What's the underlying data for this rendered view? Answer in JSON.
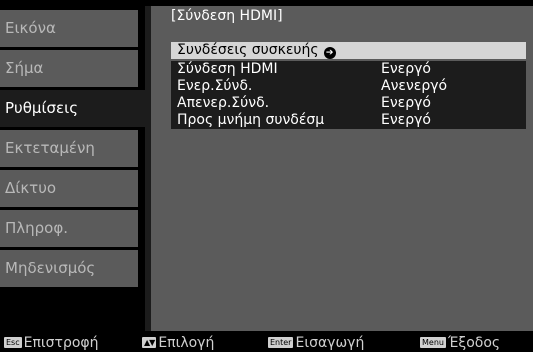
{
  "sidebar": {
    "items": [
      {
        "label": "Εικόνα"
      },
      {
        "label": "Σήμα"
      },
      {
        "label": "Ρυθμίσεις"
      },
      {
        "label": "Εκτεταμένη"
      },
      {
        "label": "Δίκτυο"
      },
      {
        "label": "Πληροφ."
      },
      {
        "label": "Μηδενισμός"
      }
    ],
    "active_index": 2
  },
  "panel": {
    "title": "[Σύνδεση HDMI]",
    "rows": [
      {
        "label": "Συνδέσεις συσκευής",
        "value": "",
        "icon": "enter-arrow-icon",
        "selected": true
      },
      {
        "label": "Σύνδεση HDMI",
        "value": "Ενεργό"
      },
      {
        "label": "Ενερ.Σύνδ.",
        "value": "Ανενεργό"
      },
      {
        "label": "Απενερ.Σύνδ.",
        "value": "Ενεργό"
      },
      {
        "label": "Προς μνήμη συνδέσμ",
        "value": "Ενεργό"
      }
    ]
  },
  "helpbar": {
    "items": [
      {
        "key": "Esc",
        "label": "Επιστροφή"
      },
      {
        "key": "▲▼",
        "label": "Επιλογή"
      },
      {
        "key": "Enter",
        "label": "Εισαγωγή"
      },
      {
        "key": "Menu",
        "label": "Έξοδος"
      }
    ]
  },
  "colors": {
    "background": "#000000",
    "panel": "#5b5b5b",
    "highlight": "#1c1c1c",
    "selected_row": "#d6d6d6"
  }
}
